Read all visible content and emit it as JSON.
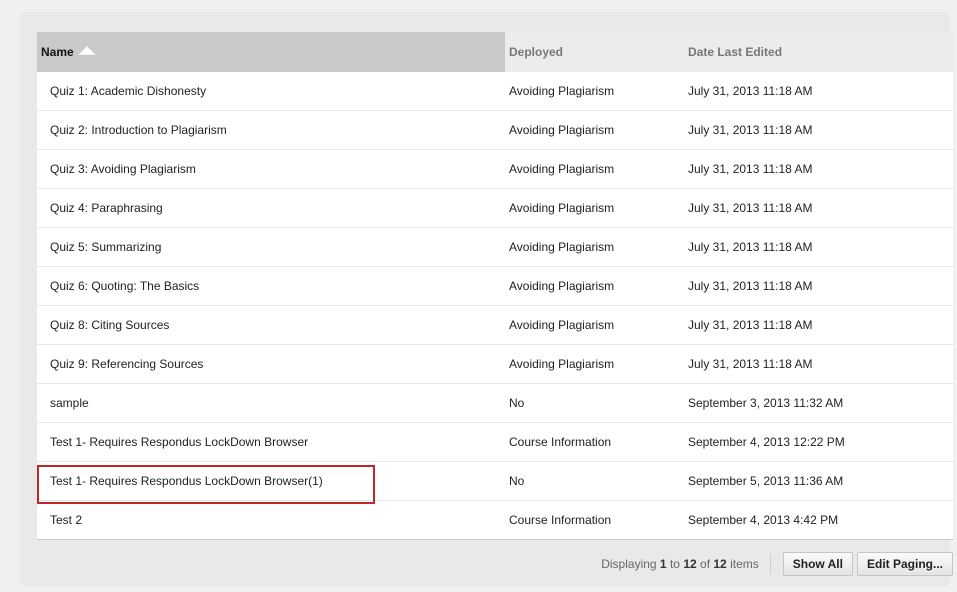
{
  "table": {
    "columns": [
      {
        "label": "Name",
        "sorted": true
      },
      {
        "label": "Deployed",
        "sorted": false
      },
      {
        "label": "Date Last Edited",
        "sorted": false
      }
    ],
    "rows": [
      {
        "name": "Quiz 1: Academic Dishonesty",
        "deployed": "Avoiding Plagiarism",
        "date": "July 31, 2013 11:18 AM"
      },
      {
        "name": "Quiz 2: Introduction to Plagiarism",
        "deployed": "Avoiding Plagiarism",
        "date": "July 31, 2013 11:18 AM"
      },
      {
        "name": "Quiz 3: Avoiding Plagiarism",
        "deployed": "Avoiding Plagiarism",
        "date": "July 31, 2013 11:18 AM"
      },
      {
        "name": "Quiz 4: Paraphrasing",
        "deployed": "Avoiding Plagiarism",
        "date": "July 31, 2013 11:18 AM"
      },
      {
        "name": "Quiz 5: Summarizing",
        "deployed": "Avoiding Plagiarism",
        "date": "July 31, 2013 11:18 AM"
      },
      {
        "name": "Quiz 6: Quoting: The Basics",
        "deployed": "Avoiding Plagiarism",
        "date": "July 31, 2013 11:18 AM"
      },
      {
        "name": "Quiz 8: Citing Sources",
        "deployed": "Avoiding Plagiarism",
        "date": "July 31, 2013 11:18 AM"
      },
      {
        "name": "Quiz 9: Referencing Sources",
        "deployed": "Avoiding Plagiarism",
        "date": "July 31, 2013 11:18 AM"
      },
      {
        "name": "sample",
        "deployed": "No",
        "date": "September 3, 2013 11:32 AM"
      },
      {
        "name": "Test 1- Requires Respondus LockDown Browser",
        "deployed": "Course Information",
        "date": "September 4, 2013 12:22 PM"
      },
      {
        "name": "Test 1- Requires Respondus LockDown Browser(1)",
        "deployed": "No",
        "date": "September 5, 2013 11:36 AM",
        "highlighted": true
      },
      {
        "name": "Test 2",
        "deployed": "Course Information",
        "date": "September 4, 2013 4:42 PM"
      }
    ]
  },
  "pager": {
    "prefix": "Displaying",
    "from": "1",
    "to_word": "to",
    "to": "12",
    "of_word": "of",
    "total": "12",
    "suffix": "items",
    "show_all_label": "Show All",
    "edit_paging_label": "Edit Paging..."
  },
  "colors": {
    "highlight_border": "#c0272d",
    "sorted_header_bg": "#c9c9c9"
  },
  "icons": {
    "sort": "sort-ascending-icon"
  }
}
